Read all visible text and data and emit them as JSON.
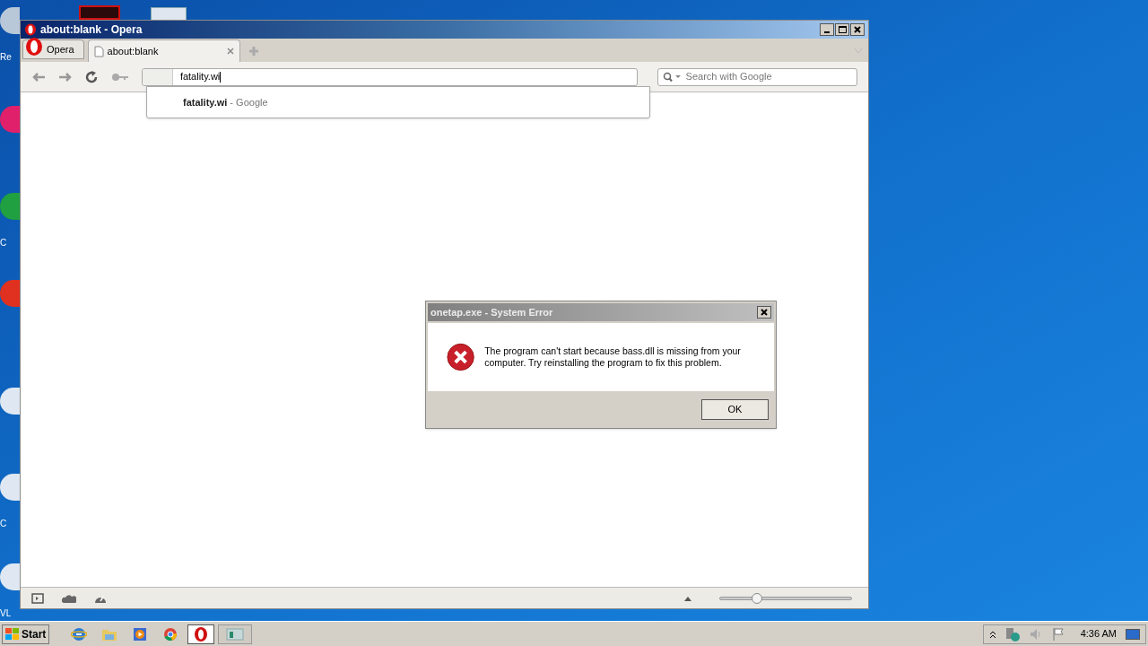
{
  "desktop_icons": [
    {
      "color": "#b8c8d8",
      "label": "Re"
    },
    {
      "color": "#e0206a"
    },
    {
      "color": "#20a040",
      "label": "C"
    },
    {
      "color": "#e03020"
    },
    {
      "color": "#dfe8f2"
    },
    {
      "color": "#dfe8f2",
      "label": "C"
    },
    {
      "color": "#dfe8f2",
      "label": "VL"
    }
  ],
  "browser": {
    "title": "about:blank - Opera",
    "menu_button": "Opera",
    "tabs": [
      {
        "label": "about:blank",
        "selected": true
      }
    ],
    "address": {
      "value": "fatality.wi"
    },
    "suggestions": [
      {
        "text": "**fatality.wi** - Google"
      }
    ],
    "search": {
      "placeholder": "Search with Google"
    },
    "zoom_slider": {
      "level": 0.28
    }
  },
  "dialog": {
    "title": "onetap.exe - System Error",
    "message": "The program can't start because bass.dll is missing from your computer. Try reinstalling the program to fix this problem.",
    "button": "OK"
  },
  "taskbar": {
    "start": "Start",
    "apps": [
      {
        "kind": "ie",
        "selected": false
      },
      {
        "kind": "folder",
        "selected": false
      },
      {
        "kind": "media",
        "selected": false
      },
      {
        "kind": "chrome",
        "selected": false
      },
      {
        "kind": "opera",
        "selected": true
      },
      {
        "kind": "window",
        "selected": false
      }
    ],
    "clock": "4:36 AM"
  }
}
